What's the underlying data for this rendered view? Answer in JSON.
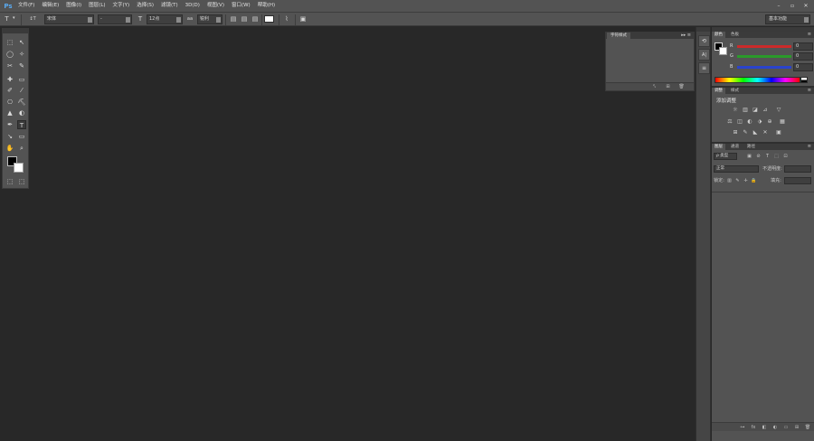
{
  "app": {
    "logo": "Ps"
  },
  "menu": [
    "文件(F)",
    "编辑(E)",
    "图像(I)",
    "图层(L)",
    "文字(Y)",
    "选择(S)",
    "滤镜(T)",
    "3D(D)",
    "视图(V)",
    "窗口(W)",
    "帮助(H)"
  ],
  "window_controls": [
    "–",
    "▫",
    "✕"
  ],
  "options": {
    "tool_icon": "T",
    "orient_icon": "↕T",
    "font_family": "宋体",
    "font_style": "-",
    "size_icon": "T",
    "font_size": "12点",
    "aa_label": "aa",
    "aa_value": "锐利",
    "workspace": "基本功能"
  },
  "tools": {
    "items": [
      "⬚",
      "↖",
      "◯",
      "✧",
      "✂",
      "✎",
      "✚",
      "▭",
      "✐",
      "⁄",
      "⎔",
      "⛏",
      "▲",
      "◐",
      "✒",
      "T",
      "↘",
      "▭",
      "✋",
      "⌕"
    ],
    "bottom": [
      "⬚",
      "⬚"
    ]
  },
  "float_panel": {
    "tab": "字符样式",
    "menu": "▸▸ ≡",
    "footer_icons": [
      "⤣",
      "⊞",
      "🗑"
    ]
  },
  "dock": {
    "icons": [
      "⟲",
      "A|",
      "≡"
    ]
  },
  "color_panel": {
    "tabs": [
      "颜色",
      "色板"
    ],
    "menu": "≡",
    "channels": [
      {
        "label": "R",
        "value": "0",
        "color": "#cc2a2a"
      },
      {
        "label": "G",
        "value": "0",
        "color": "#2a9a2a"
      },
      {
        "label": "B",
        "value": "0",
        "color": "#2a43cc"
      }
    ]
  },
  "adjust_panel": {
    "tabs": [
      "调整",
      "样式"
    ],
    "menu": "≡",
    "title": "添加调整",
    "row1": [
      "☼",
      "▥",
      "◪",
      "⊿",
      "▽"
    ],
    "row2": [
      "⚖",
      "◫",
      "◐",
      "⬗",
      "⊕",
      "▦"
    ],
    "row3": [
      "⊞",
      "✎",
      "◣",
      "✕",
      "▣"
    ]
  },
  "layers_panel": {
    "tabs": [
      "图层",
      "通道",
      "路径"
    ],
    "menu": "≡",
    "filter": "ρ 类型",
    "filter_icons": [
      "▣",
      "⊘",
      "T",
      "⬚",
      "⊡"
    ],
    "blend": "正常",
    "opacity_label": "不透明度:",
    "lock_label": "锁定:",
    "lock_icons": [
      "▥",
      "✎",
      "✛",
      "🔒"
    ],
    "fill_label": "填充:",
    "footer_icons": [
      "⊶",
      "fx",
      "◧",
      "◐",
      "▭",
      "⊞",
      "🗑"
    ]
  }
}
